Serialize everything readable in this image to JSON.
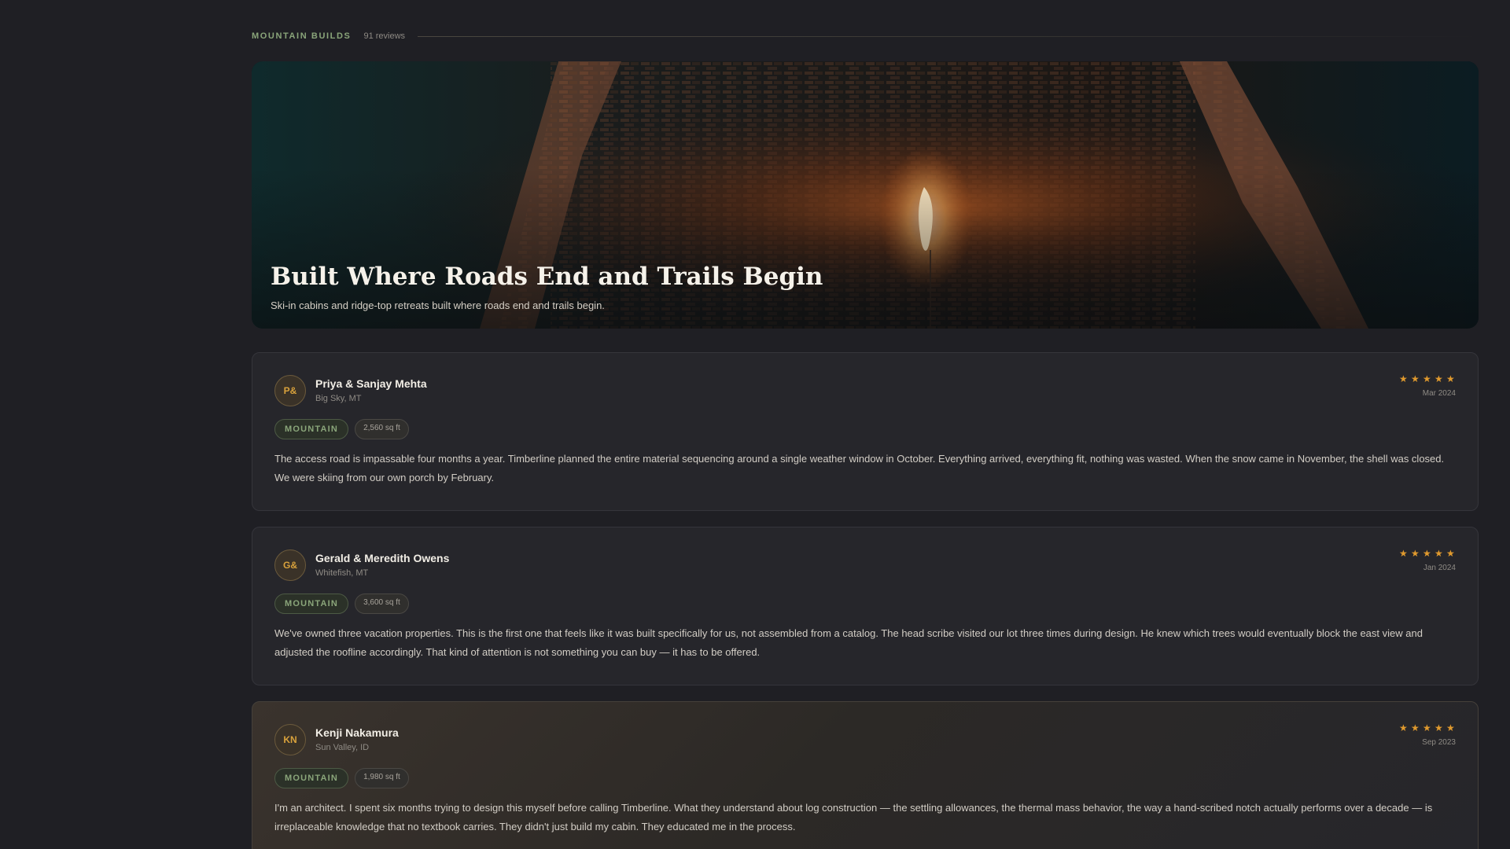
{
  "section": {
    "label": "MOUNTAIN BUILDS",
    "count": "91 reviews"
  },
  "hero": {
    "title": "Built Where Roads End and Trails Begin",
    "subtitle": "Ski-in cabins and ridge-top retreats built where roads end and trails begin."
  },
  "reviews": [
    {
      "initials": "P&",
      "name": "Priya & Sanjay Mehta",
      "location": "Big Sky, MT",
      "rating": 5,
      "date": "Mar 2024",
      "category": "MOUNTAIN",
      "size": "2,560 sq ft",
      "text": "The access road is impassable four months a year. Timberline planned the entire material sequencing around a single weather window in October. Everything arrived, everything fit, nothing was wasted. When the snow came in November, the shell was closed. We were skiing from our own porch by February."
    },
    {
      "initials": "G&",
      "name": "Gerald & Meredith Owens",
      "location": "Whitefish, MT",
      "rating": 5,
      "date": "Jan 2024",
      "category": "MOUNTAIN",
      "size": "3,600 sq ft",
      "text": "We've owned three vacation properties. This is the first one that feels like it was built specifically for us, not assembled from a catalog. The head scribe visited our lot three times during design. He knew which trees would eventually block the east view and adjusted the roofline accordingly. That kind of attention is not something you can buy — it has to be offered."
    },
    {
      "initials": "KN",
      "name": "Kenji Nakamura",
      "location": "Sun Valley, ID",
      "rating": 5,
      "date": "Sep 2023",
      "category": "MOUNTAIN",
      "size": "1,980 sq ft",
      "text": "I'm an architect. I spent six months trying to design this myself before calling Timberline. What they understand about log construction — the settling allowances, the thermal mass behavior, the way a hand-scribed notch actually performs over a decade — is irreplaceable knowledge that no textbook carries. They didn't just build my cabin. They educated me in the process."
    }
  ],
  "colors": {
    "background": "#1f1f24",
    "card": "#26262b",
    "accent_green": "#8aa57a",
    "star": "#e09a2e",
    "avatar_text": "#d9a23c"
  }
}
